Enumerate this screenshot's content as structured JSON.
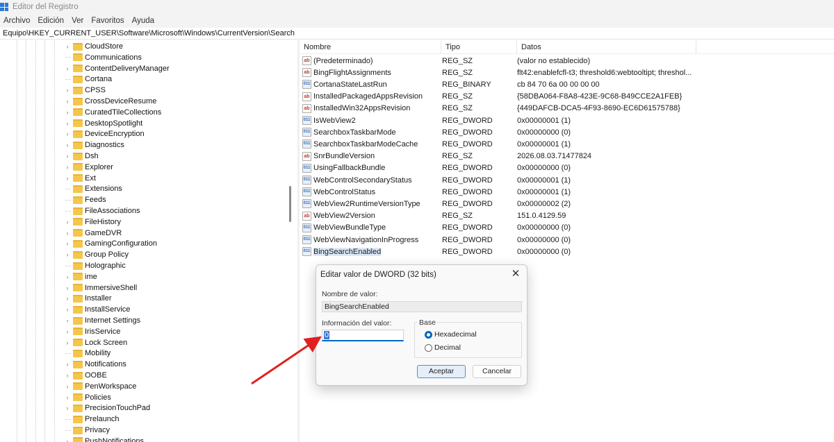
{
  "window": {
    "title": "Editor del Registro"
  },
  "menu": [
    "Archivo",
    "Edición",
    "Ver",
    "Favoritos",
    "Ayuda"
  ],
  "address": "Equipo\\HKEY_CURRENT_USER\\Software\\Microsoft\\Windows\\CurrentVersion\\Search",
  "tree": {
    "items": [
      {
        "label": "CloudStore",
        "expandable": true
      },
      {
        "label": "Communications",
        "expandable": false
      },
      {
        "label": "ContentDeliveryManager",
        "expandable": true
      },
      {
        "label": "Cortana",
        "expandable": false
      },
      {
        "label": "CPSS",
        "expandable": true
      },
      {
        "label": "CrossDeviceResume",
        "expandable": true
      },
      {
        "label": "CuratedTileCollections",
        "expandable": true
      },
      {
        "label": "DesktopSpotlight",
        "expandable": true
      },
      {
        "label": "DeviceEncryption",
        "expandable": true
      },
      {
        "label": "Diagnostics",
        "expandable": true
      },
      {
        "label": "Dsh",
        "expandable": true
      },
      {
        "label": "Explorer",
        "expandable": true
      },
      {
        "label": "Ext",
        "expandable": true
      },
      {
        "label": "Extensions",
        "expandable": false
      },
      {
        "label": "Feeds",
        "expandable": false
      },
      {
        "label": "FileAssociations",
        "expandable": false
      },
      {
        "label": "FileHistory",
        "expandable": true
      },
      {
        "label": "GameDVR",
        "expandable": true
      },
      {
        "label": "GamingConfiguration",
        "expandable": true
      },
      {
        "label": "Group Policy",
        "expandable": true
      },
      {
        "label": "Holographic",
        "expandable": false
      },
      {
        "label": "ime",
        "expandable": true
      },
      {
        "label": "ImmersiveShell",
        "expandable": true
      },
      {
        "label": "Installer",
        "expandable": true
      },
      {
        "label": "InstallService",
        "expandable": true
      },
      {
        "label": "Internet Settings",
        "expandable": true
      },
      {
        "label": "IrisService",
        "expandable": true
      },
      {
        "label": "Lock Screen",
        "expandable": true
      },
      {
        "label": "Mobility",
        "expandable": false
      },
      {
        "label": "Notifications",
        "expandable": true
      },
      {
        "label": "OOBE",
        "expandable": true
      },
      {
        "label": "PenWorkspace",
        "expandable": true
      },
      {
        "label": "Policies",
        "expandable": true
      },
      {
        "label": "PrecisionTouchPad",
        "expandable": true
      },
      {
        "label": "Prelaunch",
        "expandable": false
      },
      {
        "label": "Privacy",
        "expandable": false
      },
      {
        "label": "PushNotifications",
        "expandable": true
      }
    ]
  },
  "list": {
    "columns": [
      "Nombre",
      "Tipo",
      "Datos"
    ],
    "rows": [
      {
        "icon": "string-value-icon",
        "name": "(Predeterminado)",
        "type": "REG_SZ",
        "data": "(valor no establecido)"
      },
      {
        "icon": "string-value-icon",
        "name": "BingFlightAssignments",
        "type": "REG_SZ",
        "data": "flt42:enablefcfl-t3; threshold6:webtooltipt; threshol..."
      },
      {
        "icon": "binary-value-icon",
        "name": "CortanaStateLastRun",
        "type": "REG_BINARY",
        "data": "cb 84 70 6a 00 00 00 00"
      },
      {
        "icon": "string-value-icon",
        "name": "InstalledPackagedAppsRevision",
        "type": "REG_SZ",
        "data": "{58DBA064-F8A8-423E-9C68-B49CCE2A1FEB}"
      },
      {
        "icon": "string-value-icon",
        "name": "InstalledWin32AppsRevision",
        "type": "REG_SZ",
        "data": "{449DAFCB-DCA5-4F93-8690-EC6D61575788}"
      },
      {
        "icon": "binary-value-icon",
        "name": "IsWebView2",
        "type": "REG_DWORD",
        "data": "0x00000001 (1)"
      },
      {
        "icon": "binary-value-icon",
        "name": "SearchboxTaskbarMode",
        "type": "REG_DWORD",
        "data": "0x00000000 (0)"
      },
      {
        "icon": "binary-value-icon",
        "name": "SearchboxTaskbarModeCache",
        "type": "REG_DWORD",
        "data": "0x00000001 (1)"
      },
      {
        "icon": "string-value-icon",
        "name": "SnrBundleVersion",
        "type": "REG_SZ",
        "data": "2026.08.03.71477824"
      },
      {
        "icon": "binary-value-icon",
        "name": "UsingFallbackBundle",
        "type": "REG_DWORD",
        "data": "0x00000000 (0)"
      },
      {
        "icon": "binary-value-icon",
        "name": "WebControlSecondaryStatus",
        "type": "REG_DWORD",
        "data": "0x00000001 (1)"
      },
      {
        "icon": "binary-value-icon",
        "name": "WebControlStatus",
        "type": "REG_DWORD",
        "data": "0x00000001 (1)"
      },
      {
        "icon": "binary-value-icon",
        "name": "WebView2RuntimeVersionType",
        "type": "REG_DWORD",
        "data": "0x00000002 (2)"
      },
      {
        "icon": "string-value-icon",
        "name": "WebView2Version",
        "type": "REG_SZ",
        "data": "151.0.4129.59"
      },
      {
        "icon": "binary-value-icon",
        "name": "WebViewBundleType",
        "type": "REG_DWORD",
        "data": "0x00000000 (0)"
      },
      {
        "icon": "binary-value-icon",
        "name": "WebViewNavigationInProgress",
        "type": "REG_DWORD",
        "data": "0x00000000 (0)"
      },
      {
        "icon": "binary-value-icon",
        "name": "BingSearchEnabled",
        "type": "REG_DWORD",
        "data": "0x00000000 (0)",
        "selected": true
      }
    ]
  },
  "dialog": {
    "title": "Editar valor de DWORD (32 bits)",
    "close_glyph": "✕",
    "name_label": "Nombre de valor:",
    "name_value": "BingSearchEnabled",
    "value_label": "Información del valor:",
    "value": "0",
    "base_label": "Base",
    "base_options": [
      "Hexadecimal",
      "Decimal"
    ],
    "base_selected": "Hexadecimal",
    "ok_label": "Aceptar",
    "cancel_label": "Cancelar"
  },
  "annotation": {
    "arrow_color": "#e02020"
  },
  "colors": {
    "accent": "#0067c0",
    "folder": "#f5c64a"
  }
}
